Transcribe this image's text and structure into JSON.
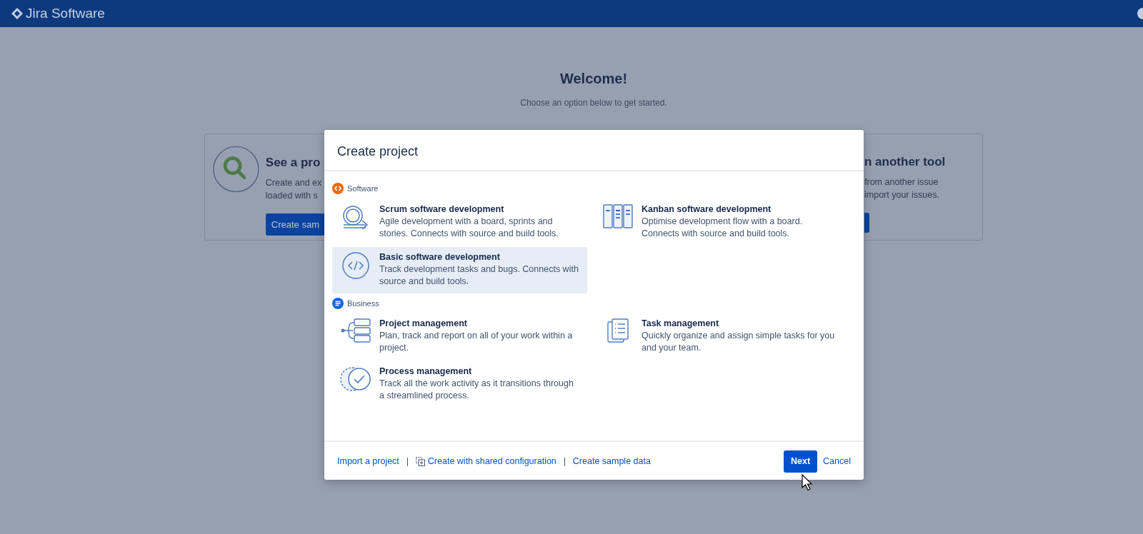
{
  "top_bar": {
    "product": "Jira Software"
  },
  "welcome": {
    "title": "Welcome!",
    "subtitle": "Choose an option below to get started."
  },
  "background_cards": [
    {
      "title": "See a pro",
      "lines": [
        "Create and ex",
        "loaded with s"
      ],
      "button": "Create sam"
    },
    {
      "title": "n another tool",
      "lines": [
        "from another issue",
        "import your issues."
      ]
    }
  ],
  "dialog": {
    "title": "Create project",
    "sections": [
      {
        "name": "Software",
        "kind": "software",
        "templates": [
          {
            "kind": "scrum",
            "title": "Scrum software development",
            "description": "Agile development with a board, sprints and stories. Connects with source and build tools.",
            "selected": false
          },
          {
            "kind": "kanban",
            "title": "Kanban software development",
            "description": "Optimise development flow with a board. Connects with source and build tools.",
            "selected": false
          },
          {
            "kind": "basic",
            "title": "Basic software development",
            "description": "Track development tasks and bugs. Connects with source and build tools.",
            "selected": true
          }
        ]
      },
      {
        "name": "Business",
        "kind": "business",
        "templates": [
          {
            "kind": "project",
            "title": "Project management",
            "description": "Plan, track and report on all of your work within a project.",
            "selected": false
          },
          {
            "kind": "task",
            "title": "Task management",
            "description": "Quickly organize and assign simple tasks for you and your team.",
            "selected": false
          },
          {
            "kind": "process",
            "title": "Process management",
            "description": "Track all the work activity as it transitions through a streamlined process.",
            "selected": false
          }
        ]
      }
    ],
    "footer_links": [
      {
        "label": "Import a project"
      },
      {
        "label": "Create with shared configuration",
        "kind": "shared"
      },
      {
        "label": "Create sample data"
      }
    ],
    "next_button": "Next",
    "cancel_link": "Cancel"
  }
}
